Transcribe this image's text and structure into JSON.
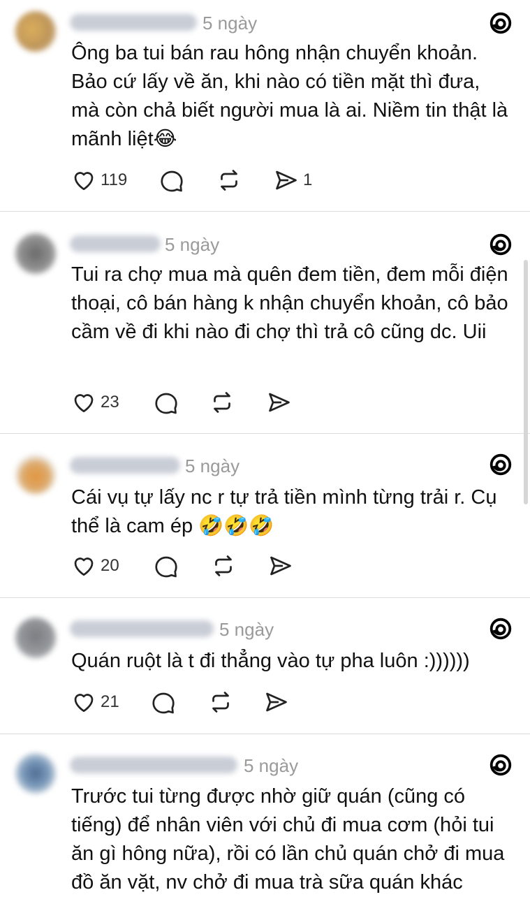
{
  "time_label": "5 ngày",
  "posts": [
    {
      "text": "Ông ba tui bán rau hông nhận chuyển khoản. Bảo cứ lấy về ăn, khi nào có tiền mặt thì đưa, mà còn chả biết người mua là ai. Niềm tin thật là mãnh liệt😂",
      "likes": "119",
      "shares": "1"
    },
    {
      "text": "Tui ra chợ mua mà quên đem tiền, đem mỗi điện thoại, cô bán hàng k nhận chuyển khoản, cô bảo cầm về đi khi nào đi chợ thì trả cô cũng dc. Uii",
      "likes": "23",
      "shares": ""
    },
    {
      "text": "Cái vụ tự lấy nc r tự trả tiền mình từng trải r. Cụ thể là cam ép 🤣🤣🤣",
      "likes": "20",
      "shares": ""
    },
    {
      "text": "Quán ruột là t đi thẳng vào tự pha luôn :))))))",
      "likes": "21",
      "shares": ""
    },
    {
      "text": "Trước tui từng được nhờ giữ quán (cũng có tiếng) để nhân viên với chủ đi mua cơm (hỏi tui ăn gì hông nữa), rồi có lần chủ quán chở đi mua đồ ăn vặt, nv chở đi mua trà sữa quán khác",
      "likes": "",
      "shares": ""
    }
  ],
  "icons": {
    "like": "heart-icon",
    "comment": "comment-bubble-icon",
    "repost": "repost-icon",
    "share": "send-icon",
    "brand": "threads-logo-icon"
  }
}
